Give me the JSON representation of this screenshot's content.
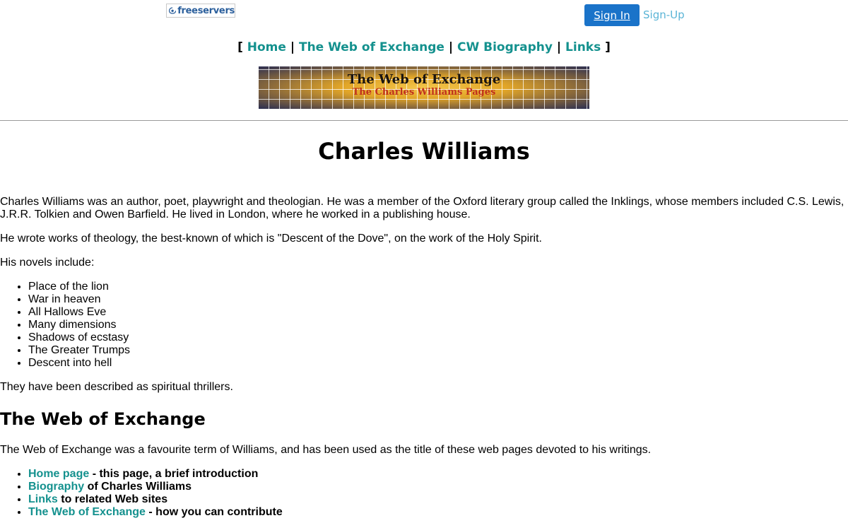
{
  "header": {
    "logo_text": "freeservers",
    "signin_label": "Sign In",
    "signup_label": "Sign-Up"
  },
  "topnav": {
    "open_bracket": "[",
    "close_bracket": "]",
    "separator": "|",
    "items": [
      "Home",
      "The Web of Exchange",
      "CW Biography",
      "Links"
    ]
  },
  "banner": {
    "title": "The Web of Exchange",
    "subtitle": "The Charles Williams Pages"
  },
  "main": {
    "title": "Charles Williams",
    "intro_p1": "Charles Williams was an author, poet, playwright and theologian. He was a member of the Oxford literary group called the Inklings, whose members included C.S. Lewis, J.R.R. Tolkien and Owen Barfield. He lived in London, where he worked in a publishing house.",
    "intro_p2": "He wrote works of theology, the best-known of which is \"Descent of the Dove\", on the work of the Holy Spirit.",
    "novels_intro": "His novels include:",
    "novels": [
      "Place of the lion",
      "War in heaven",
      "All Hallows Eve",
      "Many dimensions",
      "Shadows of ecstasy",
      "The Greater Trumps",
      "Descent into hell"
    ],
    "novels_outro": "They have been described as spiritual thrillers.",
    "section_title": "The Web of Exchange",
    "section_p": "The Web of Exchange was a favourite term of Williams, and has been used as the title of these web pages devoted to his writings.",
    "links": [
      {
        "link": "Home page",
        "text": " - this page, a brief introduction"
      },
      {
        "link": "Biography",
        "text": " of Charles Williams"
      },
      {
        "link": "Links",
        "text": " to related Web sites"
      },
      {
        "link": "The Web of Exchange",
        "text": " - how you can contribute"
      }
    ]
  },
  "colors": {
    "link": "#14918e",
    "signin_bg": "#1a73c9",
    "signup": "#5ab4d6"
  }
}
